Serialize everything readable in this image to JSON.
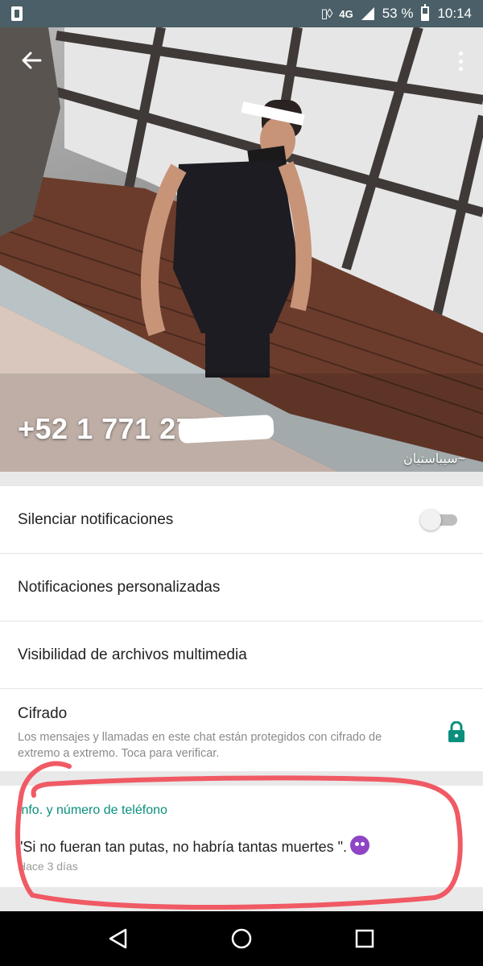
{
  "status_bar": {
    "network": "4G",
    "battery": "53 %",
    "battery_level": 0.53,
    "time": "10:14"
  },
  "profile": {
    "phone_number": "+52 1 771 272",
    "username": "~سيباستيان"
  },
  "settings": {
    "mute_label": "Silenciar notificaciones",
    "mute_enabled": false,
    "custom_notifications_label": "Notificaciones personalizadas",
    "media_visibility_label": "Visibilidad de archivos multimedia",
    "encryption_title": "Cifrado",
    "encryption_description": "Los mensajes y llamadas en este chat están protegidos con cifrado de extremo a extremo. Toca para verificar."
  },
  "info": {
    "section_title": "Info. y número de teléfono",
    "status_text": "\"Si no fueran tan putas, no habría tantas muertes \".",
    "status_date": "Hace 3 días"
  },
  "colors": {
    "status_bar": "#4a5f67",
    "accent": "#0a8f7d",
    "highlight": "#f05a64"
  },
  "icons": {
    "back": "arrow-left",
    "more": "three-dots-vertical",
    "lock": "lock",
    "nav_back": "triangle-left",
    "nav_home": "circle",
    "nav_recents": "square"
  }
}
